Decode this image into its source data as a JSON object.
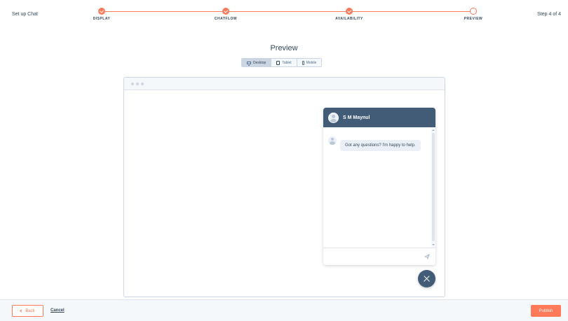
{
  "header": {
    "title": "Set up Chat",
    "step_counter": "Step 4 of 4",
    "steps": [
      {
        "label": "DISPLAY",
        "status": "complete"
      },
      {
        "label": "CHATFLOW",
        "status": "complete"
      },
      {
        "label": "AVAILABILITY",
        "status": "complete"
      },
      {
        "label": "PREVIEW",
        "status": "current"
      }
    ]
  },
  "preview": {
    "title": "Preview",
    "device_tabs": [
      {
        "label": "Desktop",
        "icon": "desktop-icon",
        "selected": true
      },
      {
        "label": "Tablet",
        "icon": "tablet-icon",
        "selected": false
      },
      {
        "label": "Mobile",
        "icon": "mobile-icon",
        "selected": false
      }
    ]
  },
  "chat": {
    "agent_name": "S M Maynul",
    "welcome_message": "Got any questions? I'm happy to help.",
    "input_placeholder": ""
  },
  "footer": {
    "back_label": "Back",
    "cancel_label": "Cancel",
    "publish_label": "Publish"
  },
  "colors": {
    "accent": "#ff7a59",
    "chat_header": "#425b76",
    "text": "#33475b"
  }
}
